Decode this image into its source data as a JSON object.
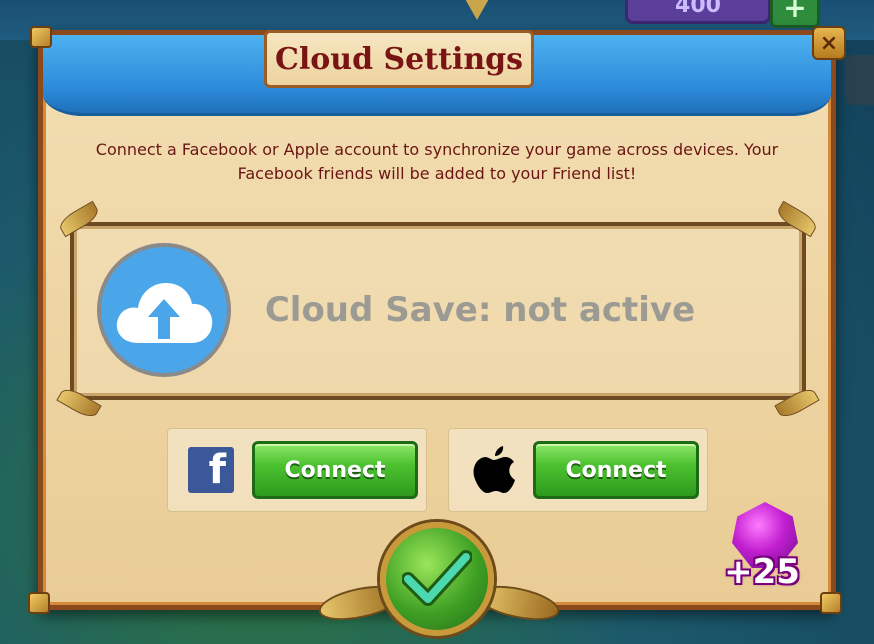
{
  "hud": {
    "gem_count": "400",
    "plus_label": "+"
  },
  "dialog": {
    "title": "Cloud Settings",
    "close_label": "×",
    "description": "Connect a Facebook or Apple account to synchronize your game across devices. Your Facebook friends will be added to your Friend list!",
    "status_text": "Cloud Save: not active",
    "facebook": {
      "logo_letter": "f",
      "button_label": "Connect",
      "icon": "facebook-logo-icon"
    },
    "apple": {
      "button_label": "Connect",
      "icon": "apple-logo-icon"
    },
    "confirm_icon": "checkmark-icon",
    "cloud_icon": "cloud-upload-icon"
  },
  "reward": {
    "label": "+25",
    "icon": "purple-gem-icon"
  },
  "colors": {
    "title": "#7a1414",
    "connect_button": "#4cc22f",
    "cloud_circle": "#4aa6e8",
    "facebook_blue": "#3b5998"
  }
}
